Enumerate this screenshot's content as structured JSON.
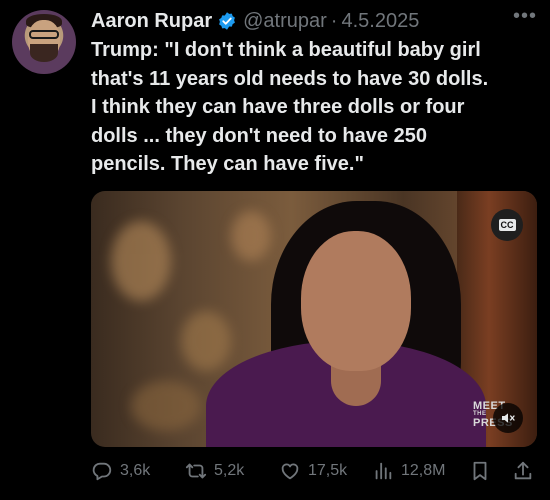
{
  "author": {
    "name": "Aaron Rupar",
    "handle": "@atrupar",
    "separator": "·",
    "date": "4.5.2025",
    "verified_color": "#1d9bf0"
  },
  "more_icon": "more-horizontal-icon",
  "tweet_lines": [
    "Trump: \"I don't think a beautiful baby girl",
    "that's 11 years old needs to have 30 dolls.",
    "I think they can have three dolls or four",
    "dolls ... they don't need to have 250",
    "pencils. They can have five.\""
  ],
  "media": {
    "cc_label": "CC",
    "watermark_lines": [
      "MEET",
      "THE",
      "PRESS"
    ]
  },
  "actions": {
    "replies": "3,6k",
    "retweets": "5,2k",
    "likes": "17,5k",
    "views": "12,8M"
  },
  "colors": {
    "background": "#000000",
    "text": "#e7e9ea",
    "secondary": "#71767b"
  }
}
